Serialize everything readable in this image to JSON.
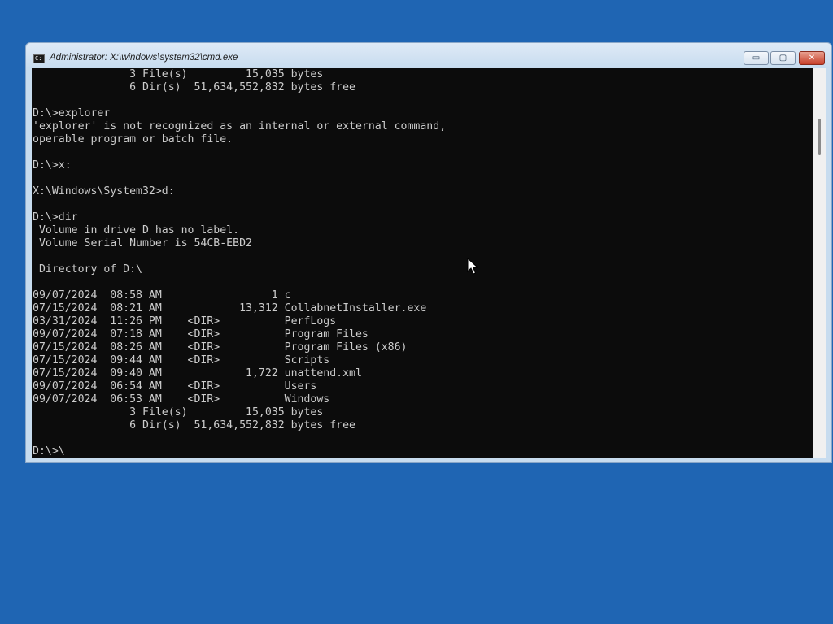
{
  "window": {
    "title": "Administrator: X:\\windows\\system32\\cmd.exe",
    "icon": "cmd-prompt-icon",
    "controls": {
      "minimize": "▭",
      "maximize": "▢",
      "close": "✕"
    }
  },
  "console": {
    "lines": [
      "               3 File(s)         15,035 bytes",
      "               6 Dir(s)  51,634,552,832 bytes free",
      "",
      "D:\\>explorer",
      "'explorer' is not recognized as an internal or external command,",
      "operable program or batch file.",
      "",
      "D:\\>x:",
      "",
      "X:\\Windows\\System32>d:",
      "",
      "D:\\>dir",
      " Volume in drive D has no label.",
      " Volume Serial Number is 54CB-EBD2",
      "",
      " Directory of D:\\",
      "",
      "09/07/2024  08:58 AM                 1 c",
      "07/15/2024  08:21 AM            13,312 CollabnetInstaller.exe",
      "03/31/2024  11:26 PM    <DIR>          PerfLogs",
      "09/07/2024  07:18 AM    <DIR>          Program Files",
      "07/15/2024  08:26 AM    <DIR>          Program Files (x86)",
      "07/15/2024  09:44 AM    <DIR>          Scripts",
      "07/15/2024  09:40 AM             1,722 unattend.xml",
      "09/07/2024  06:54 AM    <DIR>          Users",
      "09/07/2024  06:53 AM    <DIR>          Windows",
      "               3 File(s)         15,035 bytes",
      "               6 Dir(s)  51,634,552,832 bytes free",
      "",
      "D:\\>\\"
    ]
  },
  "colors": {
    "desktop": "#1f65b3",
    "console_bg": "#0c0c0c",
    "console_text": "#cccccc"
  }
}
